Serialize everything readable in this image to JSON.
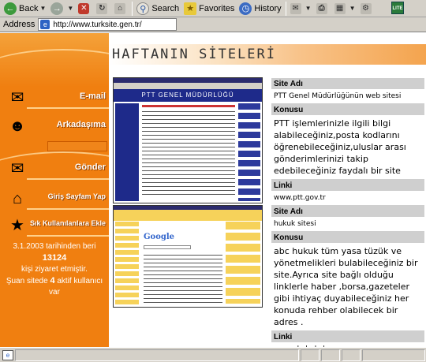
{
  "toolbar": {
    "back_label": "Back",
    "search_label": "Search",
    "favorites_label": "Favorites",
    "history_label": "History",
    "logo_text": "LITE"
  },
  "address": {
    "label": "Address",
    "url": "http://www.turksite.gen.tr/"
  },
  "sidebar": {
    "email_label": "E-mail",
    "friend_label": "Arkadaşıma",
    "send_label": "Gönder",
    "homepage_label": "Giriş Sayfam Yap",
    "favorites_label": "Sık Kullanılanlara Ekle",
    "stats": {
      "line1": "3.1.2003 tarihinden beri",
      "count": "13124",
      "line3": "kişi ziyaret etmiştir.",
      "line4_prefix": "Şuan sitede",
      "active": "4",
      "line4_suffix": "aktif kullanıcı var"
    }
  },
  "main": {
    "title": "HAFTANIN SİTELERİ",
    "sites": [
      {
        "site_name_header": "Site Adı",
        "site_name": "PTT Genel Müdürlüğünün web sitesi",
        "topic_header": "Konusu",
        "topic": "PTT işlemlerinizle ilgili bilgi alabileceğiniz,posta kodlarını öğrenebileceğiniz,uluslar arası gönderimlerinizi takip edebileceğiniz faydalı bir site",
        "link_header": "Linki",
        "link": "www.ptt.gov.tr",
        "screenshot_title": "PTT GENEL MÜDÜRLÜĞÜ"
      },
      {
        "site_name_header": "Site Adı",
        "site_name": "hukuk sitesi",
        "topic_header": "Konusu",
        "topic": "abc hukuk tüm yasa tüzük ve yönetmelikleri bulabileceğiniz bir site.Ayrıca site bağlı olduğu linklerle haber ,borsa,gazeteler gibi ihtiyaç duyabileceğiniz her konuda rehber olabilecek bir adres .",
        "link_header": "Linki",
        "link": "www.abchukuk.com",
        "screenshot_logo": "Google"
      }
    ]
  },
  "colors": {
    "sidebar_orange": "#f07f10",
    "table_header_gray": "#cfcfcf",
    "chrome_gray": "#d4d0c8"
  }
}
